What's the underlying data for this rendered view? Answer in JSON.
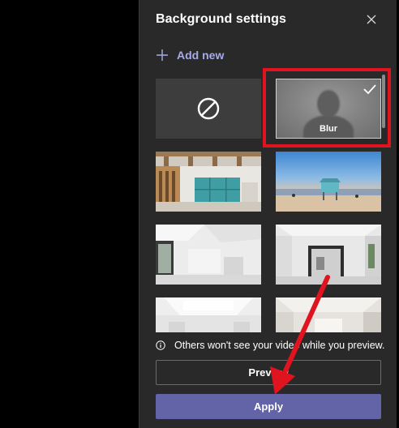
{
  "dialog": {
    "title": "Background settings",
    "add_new_label": "Add new"
  },
  "backgrounds": {
    "none_option": "none",
    "blur_label": "Blur",
    "selected": "Blur",
    "thumbnails": [
      {
        "name": "office-wood-beams"
      },
      {
        "name": "beach-lifeguard-tower"
      },
      {
        "name": "white-loft-room"
      },
      {
        "name": "white-room-mirror"
      },
      {
        "name": "bright-skylight-room"
      },
      {
        "name": "white-room-doorway"
      }
    ]
  },
  "notice": {
    "text": "Others won't see your video while you preview."
  },
  "buttons": {
    "preview": "Preview",
    "apply": "Apply"
  },
  "colors": {
    "panel_bg": "#292929",
    "accent": "#6264a7",
    "link": "#a7abe8",
    "highlight": "#e0141f"
  }
}
